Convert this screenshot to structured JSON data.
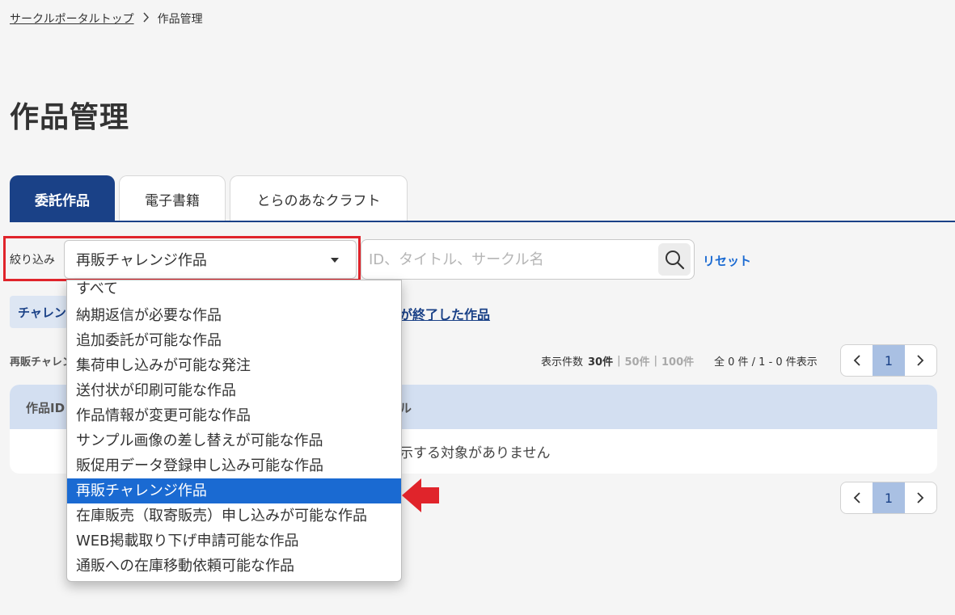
{
  "breadcrumb": {
    "home": "サークルポータルトップ",
    "separator": "＞",
    "current": "作品管理"
  },
  "page_title": "作品管理",
  "tabs": [
    {
      "label": "委託作品",
      "active": true
    },
    {
      "label": "電子書籍",
      "active": false
    },
    {
      "label": "とらのあなクラフト",
      "active": false
    }
  ],
  "filter": {
    "label": "絞り込み",
    "selected": "再販チャレンジ作品",
    "options": [
      "すべて",
      "納期返信が必要な作品",
      "追加委託が可能な作品",
      "集荷申し込みが可能な発注",
      "送付状が印刷可能な作品",
      "作品情報が変更可能な作品",
      "サンプル画像の差し替えが可能な作品",
      "販促用データ登録申し込み可能な作品",
      "再販チャレンジ作品",
      "在庫販売（取寄販売）申し込みが可能な作品",
      "WEB掲載取り下げ申請可能な作品",
      "通販への在庫移動依頼可能な作品"
    ]
  },
  "search": {
    "placeholder": "ID、タイトル、サークル名",
    "value": ""
  },
  "reset_label": "リセット",
  "chip_label": "チャレンジ",
  "ended_link": "ジが終了した作品",
  "filter_caption": "再販チャレンジ",
  "per_page": {
    "label": "表示件数",
    "current": "30件",
    "options": [
      "50件",
      "100件"
    ],
    "separator": "|"
  },
  "count_info": "全 0 件 / 1 - 0 件表示",
  "pager": {
    "prev": "‹",
    "page": "1",
    "next": "›"
  },
  "table": {
    "columns": [
      "作品ID",
      "タイトル"
    ],
    "empty_message": "表示する対象がありません"
  },
  "colors": {
    "accent": "#1a4187",
    "link": "#1a6ad2",
    "highlight": "#e0242b"
  }
}
